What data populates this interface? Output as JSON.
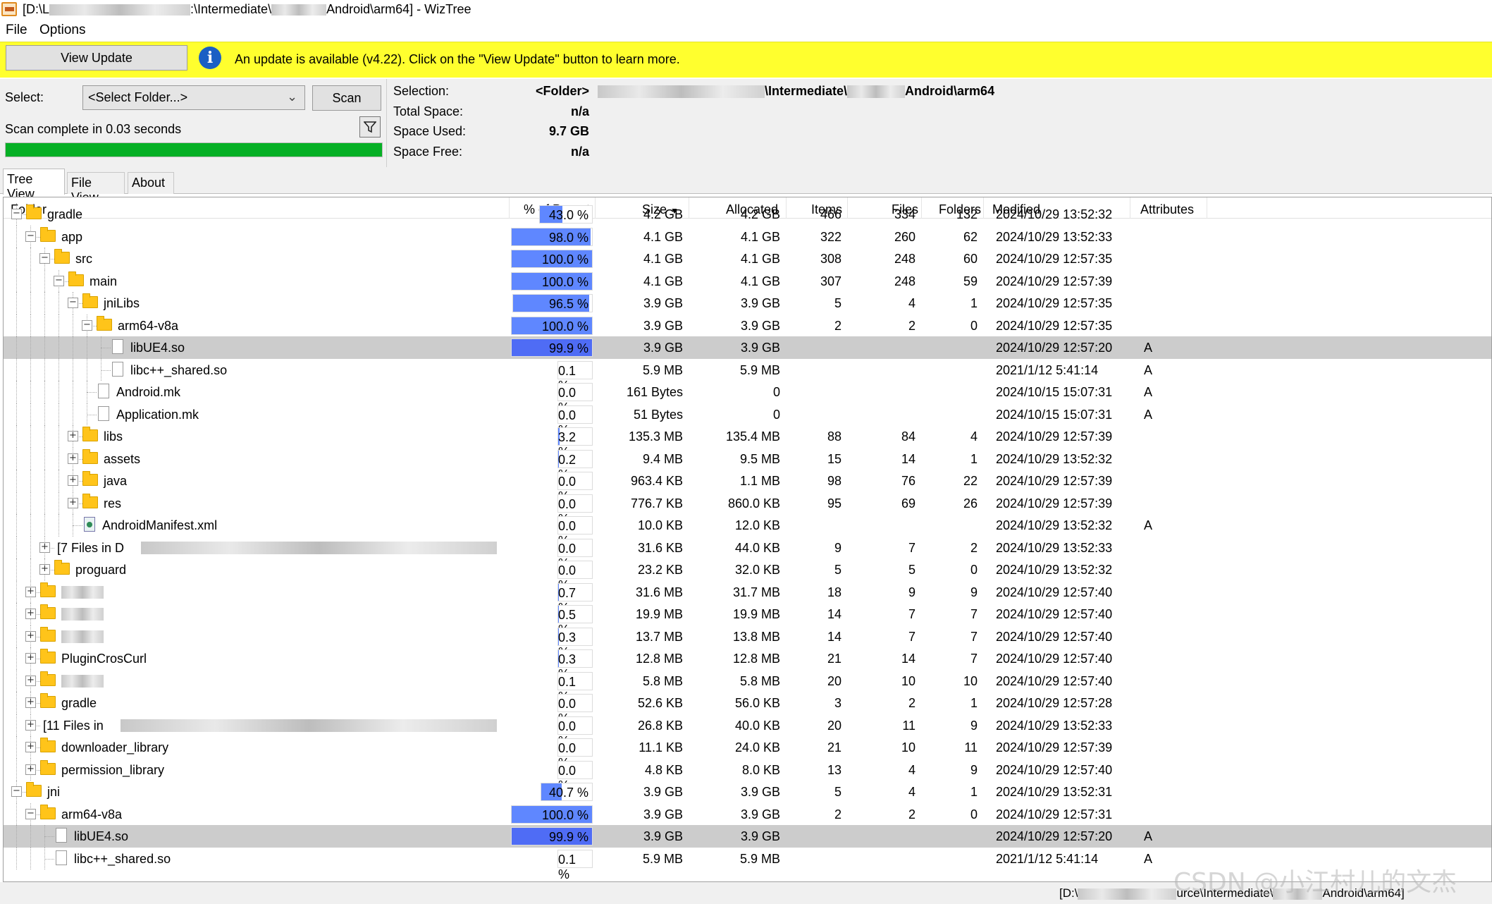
{
  "window": {
    "title_prefix": "[D:\\L",
    "title_mid1": ":\\Intermediate\\",
    "title_mid2": "Android\\arm64]",
    "title_suffix": " - WizTree"
  },
  "menu": [
    "File",
    "Options"
  ],
  "update_bar": {
    "button_label": "View Update",
    "message": "An update is available (v4.22). Click on the \"View Update\" button to learn more."
  },
  "controls": {
    "select_label": "Select:",
    "select_value": "<Select Folder...>",
    "scan_label": "Scan",
    "status": "Scan complete in 0.03 seconds",
    "progress": 1.0
  },
  "info": {
    "selection_label": "Selection:",
    "selection_value": "<Folder>",
    "selection_path_a": "\\Intermediate\\",
    "selection_path_b": "Android\\arm64",
    "total_space_label": "Total Space:",
    "total_space_value": "n/a",
    "space_used_label": "Space Used:",
    "space_used_value": "9.7 GB",
    "space_free_label": "Space Free:",
    "space_free_value": "n/a"
  },
  "tabs": [
    "Tree View",
    "File View",
    "About"
  ],
  "columns": {
    "folder": "Folder",
    "pct": "% of Parent",
    "size": "Size",
    "allocated": "Allocated",
    "items": "Items",
    "files": "Files",
    "folders": "Folders",
    "modified": "Modified",
    "attributes": "Attributes"
  },
  "rows": [
    {
      "name": "gradle",
      "pct": "43.0 %",
      "p": 43.0,
      "size": "4.2 GB",
      "alloc": "4.2 GB",
      "items": "466",
      "files": "334",
      "folders": "132",
      "mod": "2024/10/29 13:52:32",
      "attr": "",
      "lvl": 1,
      "t": "folder",
      "exp": "-"
    },
    {
      "name": "app",
      "pct": "98.0 %",
      "p": 98.0,
      "size": "4.1 GB",
      "alloc": "4.1 GB",
      "items": "322",
      "files": "260",
      "folders": "62",
      "mod": "2024/10/29 13:52:33",
      "attr": "",
      "lvl": 2,
      "t": "folder",
      "exp": "-"
    },
    {
      "name": "src",
      "pct": "100.0 %",
      "p": 100.0,
      "size": "4.1 GB",
      "alloc": "4.1 GB",
      "items": "308",
      "files": "248",
      "folders": "60",
      "mod": "2024/10/29 12:57:35",
      "attr": "",
      "lvl": 3,
      "t": "folder",
      "exp": "-"
    },
    {
      "name": "main",
      "pct": "100.0 %",
      "p": 100.0,
      "size": "4.1 GB",
      "alloc": "4.1 GB",
      "items": "307",
      "files": "248",
      "folders": "59",
      "mod": "2024/10/29 12:57:39",
      "attr": "",
      "lvl": 4,
      "t": "folder",
      "exp": "-"
    },
    {
      "name": "jniLibs",
      "pct": "96.5 %",
      "p": 96.5,
      "size": "3.9 GB",
      "alloc": "3.9 GB",
      "items": "5",
      "files": "4",
      "folders": "1",
      "mod": "2024/10/29 12:57:35",
      "attr": "",
      "lvl": 5,
      "t": "folder",
      "exp": "-"
    },
    {
      "name": "arm64-v8a",
      "pct": "100.0 %",
      "p": 100.0,
      "size": "3.9 GB",
      "alloc": "3.9 GB",
      "items": "2",
      "files": "2",
      "folders": "0",
      "mod": "2024/10/29 12:57:35",
      "attr": "",
      "lvl": 6,
      "t": "folder",
      "exp": "-"
    },
    {
      "name": "libUE4.so",
      "pct": "99.9 %",
      "p": 99.9,
      "size": "3.9 GB",
      "alloc": "3.9 GB",
      "items": "",
      "files": "",
      "folders": "",
      "mod": "2024/10/29 12:57:20",
      "attr": "A",
      "lvl": 7,
      "t": "file",
      "exp": "",
      "sel": true
    },
    {
      "name": "libc++_shared.so",
      "pct": "0.1 %",
      "p": 0.1,
      "size": "5.9 MB",
      "alloc": "5.9 MB",
      "items": "",
      "files": "",
      "folders": "",
      "mod": "2021/1/12 5:41:14",
      "attr": "A",
      "lvl": 7,
      "t": "file",
      "exp": ""
    },
    {
      "name": "Android.mk",
      "pct": "0.0 %",
      "p": 0,
      "size": "161 Bytes",
      "alloc": "0",
      "items": "",
      "files": "",
      "folders": "",
      "mod": "2024/10/15 15:07:31",
      "attr": "A",
      "lvl": 6,
      "t": "file",
      "exp": ""
    },
    {
      "name": "Application.mk",
      "pct": "0.0 %",
      "p": 0,
      "size": "51 Bytes",
      "alloc": "0",
      "items": "",
      "files": "",
      "folders": "",
      "mod": "2024/10/15 15:07:31",
      "attr": "A",
      "lvl": 6,
      "t": "file",
      "exp": ""
    },
    {
      "name": "libs",
      "pct": "3.2 %",
      "p": 3.2,
      "size": "135.3 MB",
      "alloc": "135.4 MB",
      "items": "88",
      "files": "84",
      "folders": "4",
      "mod": "2024/10/29 12:57:39",
      "attr": "",
      "lvl": 5,
      "t": "folder",
      "exp": "+"
    },
    {
      "name": "assets",
      "pct": "0.2 %",
      "p": 0.2,
      "size": "9.4 MB",
      "alloc": "9.5 MB",
      "items": "15",
      "files": "14",
      "folders": "1",
      "mod": "2024/10/29 13:52:32",
      "attr": "",
      "lvl": 5,
      "t": "folder",
      "exp": "+"
    },
    {
      "name": "java",
      "pct": "0.0 %",
      "p": 0,
      "size": "963.4 KB",
      "alloc": "1.1 MB",
      "items": "98",
      "files": "76",
      "folders": "22",
      "mod": "2024/10/29 12:57:39",
      "attr": "",
      "lvl": 5,
      "t": "folder",
      "exp": "+"
    },
    {
      "name": "res",
      "pct": "0.0 %",
      "p": 0,
      "size": "776.7 KB",
      "alloc": "860.0 KB",
      "items": "95",
      "files": "69",
      "folders": "26",
      "mod": "2024/10/29 12:57:39",
      "attr": "",
      "lvl": 5,
      "t": "folder",
      "exp": "+"
    },
    {
      "name": "AndroidManifest.xml",
      "pct": "0.0 %",
      "p": 0,
      "size": "10.0 KB",
      "alloc": "12.0 KB",
      "items": "",
      "files": "",
      "folders": "",
      "mod": "2024/10/29 13:52:32",
      "attr": "A",
      "lvl": 5,
      "t": "xml",
      "exp": ""
    },
    {
      "name": "[7 Files in D",
      "pct": "0.0 %",
      "p": 0,
      "size": "31.6 KB",
      "alloc": "44.0 KB",
      "items": "9",
      "files": "7",
      "folders": "2",
      "mod": "2024/10/29 13:52:33",
      "attr": "",
      "lvl": 3,
      "t": "none",
      "exp": "+",
      "blur": true
    },
    {
      "name": "proguard",
      "pct": "0.0 %",
      "p": 0,
      "size": "23.2 KB",
      "alloc": "32.0 KB",
      "items": "5",
      "files": "5",
      "folders": "0",
      "mod": "2024/10/29 13:52:32",
      "attr": "",
      "lvl": 3,
      "t": "folder",
      "exp": "+"
    },
    {
      "name": "",
      "pct": "0.7 %",
      "p": 0.7,
      "size": "31.6 MB",
      "alloc": "31.7 MB",
      "items": "18",
      "files": "9",
      "folders": "9",
      "mod": "2024/10/29 12:57:40",
      "attr": "",
      "lvl": 2,
      "t": "folder",
      "exp": "+",
      "blur": true
    },
    {
      "name": "",
      "pct": "0.5 %",
      "p": 0.5,
      "size": "19.9 MB",
      "alloc": "19.9 MB",
      "items": "14",
      "files": "7",
      "folders": "7",
      "mod": "2024/10/29 12:57:40",
      "attr": "",
      "lvl": 2,
      "t": "folder",
      "exp": "+",
      "blur": true
    },
    {
      "name": "",
      "pct": "0.3 %",
      "p": 0.3,
      "size": "13.7 MB",
      "alloc": "13.8 MB",
      "items": "14",
      "files": "7",
      "folders": "7",
      "mod": "2024/10/29 12:57:40",
      "attr": "",
      "lvl": 2,
      "t": "folder",
      "exp": "+",
      "blur": true
    },
    {
      "name": "PluginCrosCurl",
      "pct": "0.3 %",
      "p": 0.3,
      "size": "12.8 MB",
      "alloc": "12.8 MB",
      "items": "21",
      "files": "14",
      "folders": "7",
      "mod": "2024/10/29 12:57:40",
      "attr": "",
      "lvl": 2,
      "t": "folder",
      "exp": "+"
    },
    {
      "name": "",
      "pct": "0.1 %",
      "p": 0.1,
      "size": "5.8 MB",
      "alloc": "5.8 MB",
      "items": "20",
      "files": "10",
      "folders": "10",
      "mod": "2024/10/29 12:57:40",
      "attr": "",
      "lvl": 2,
      "t": "folder",
      "exp": "+",
      "blur": true
    },
    {
      "name": "gradle",
      "pct": "0.0 %",
      "p": 0,
      "size": "52.6 KB",
      "alloc": "56.0 KB",
      "items": "3",
      "files": "2",
      "folders": "1",
      "mod": "2024/10/29 12:57:28",
      "attr": "",
      "lvl": 2,
      "t": "folder",
      "exp": "+"
    },
    {
      "name": "[11 Files in",
      "pct": "0.0 %",
      "p": 0,
      "size": "26.8 KB",
      "alloc": "40.0 KB",
      "items": "20",
      "files": "11",
      "folders": "9",
      "mod": "2024/10/29 13:52:33",
      "attr": "",
      "lvl": 2,
      "t": "none",
      "exp": "+",
      "blur": true
    },
    {
      "name": "downloader_library",
      "pct": "0.0 %",
      "p": 0,
      "size": "11.1 KB",
      "alloc": "24.0 KB",
      "items": "21",
      "files": "10",
      "folders": "11",
      "mod": "2024/10/29 12:57:39",
      "attr": "",
      "lvl": 2,
      "t": "folder",
      "exp": "+"
    },
    {
      "name": "permission_library",
      "pct": "0.0 %",
      "p": 0,
      "size": "4.8 KB",
      "alloc": "8.0 KB",
      "items": "13",
      "files": "4",
      "folders": "9",
      "mod": "2024/10/29 12:57:40",
      "attr": "",
      "lvl": 2,
      "t": "folder",
      "exp": "+"
    },
    {
      "name": "jni",
      "pct": "40.7 %",
      "p": 40.7,
      "size": "3.9 GB",
      "alloc": "3.9 GB",
      "items": "5",
      "files": "4",
      "folders": "1",
      "mod": "2024/10/29 13:52:31",
      "attr": "",
      "lvl": 1,
      "t": "folder",
      "exp": "-"
    },
    {
      "name": "arm64-v8a",
      "pct": "100.0 %",
      "p": 100.0,
      "size": "3.9 GB",
      "alloc": "3.9 GB",
      "items": "2",
      "files": "2",
      "folders": "0",
      "mod": "2024/10/29 12:57:31",
      "attr": "",
      "lvl": 2,
      "t": "folder",
      "exp": "-"
    },
    {
      "name": "libUE4.so",
      "pct": "99.9 %",
      "p": 99.9,
      "size": "3.9 GB",
      "alloc": "3.9 GB",
      "items": "",
      "files": "",
      "folders": "",
      "mod": "2024/10/29 12:57:20",
      "attr": "A",
      "lvl": 3,
      "t": "file",
      "exp": "",
      "sel": true
    },
    {
      "name": "libc++_shared.so",
      "pct": "0.1 %",
      "p": 0.1,
      "size": "5.9 MB",
      "alloc": "5.9 MB",
      "items": "",
      "files": "",
      "folders": "",
      "mod": "2021/1/12 5:41:14",
      "attr": "A",
      "lvl": 3,
      "t": "file",
      "exp": ""
    }
  ],
  "statusbar": {
    "path_prefix": "[D:\\",
    "path_mid": "urce\\Intermediate\\",
    "path_end": "Android\\arm64]"
  },
  "watermark": "CSDN @小江村儿的文杰",
  "colors": {
    "progress": "#06b025",
    "update_bar": "#ffff2e",
    "pct_bar": "#5f87ff",
    "selected_row": "#cccccc"
  }
}
